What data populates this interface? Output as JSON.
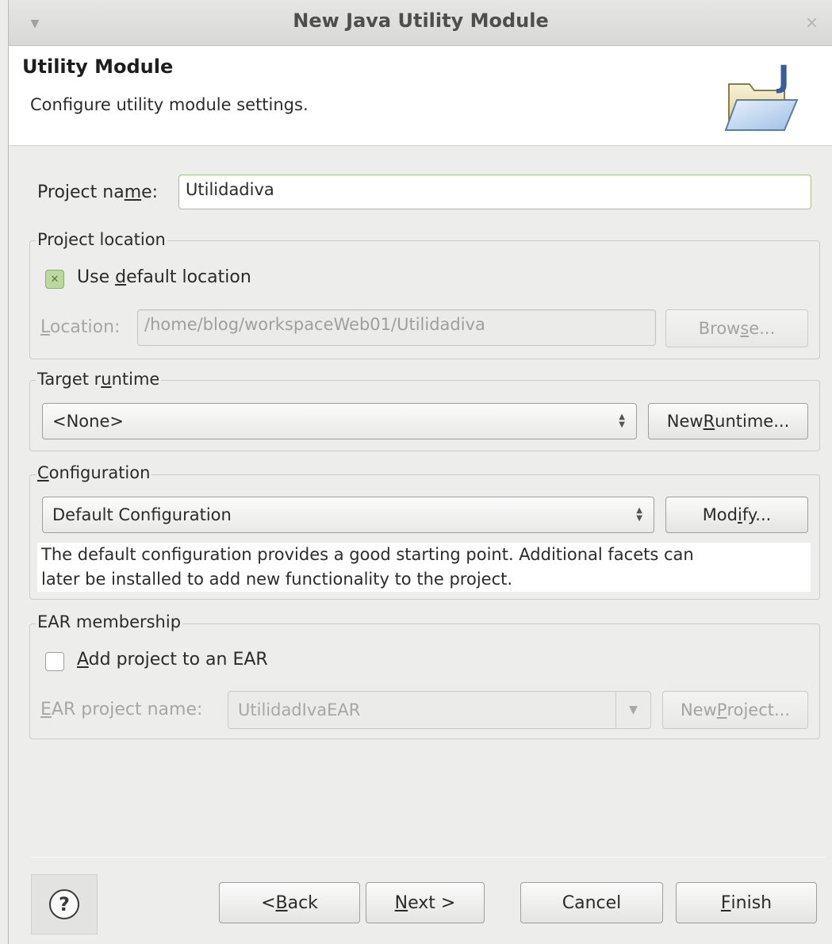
{
  "titlebar": {
    "title": "New Java Utility Module",
    "menu_icon": "chevron-down-icon",
    "close_icon": "close-icon",
    "close_glyph": "×"
  },
  "header": {
    "title": "Utility Module",
    "description": "Configure utility module settings.",
    "icon": "java-folder-icon"
  },
  "project_name": {
    "label_prefix": "Project na",
    "label_mnemonic": "m",
    "label_suffix": "e:",
    "value": "Utilidadiva"
  },
  "project_location": {
    "group_label": "Project location",
    "use_default": {
      "label_prefix": "Use ",
      "label_mnemonic": "d",
      "label_suffix": "efault location",
      "checked": true
    },
    "location": {
      "label_mnemonic": "L",
      "label_suffix": "ocation:",
      "value": "/home/blog/workspaceWeb01/Utilidadiva"
    },
    "browse_button": {
      "prefix": "Brow",
      "mnemonic": "s",
      "suffix": "e..."
    }
  },
  "target_runtime": {
    "group_label_prefix": "Target r",
    "group_label_mnemonic": "u",
    "group_label_suffix": "ntime",
    "selected": "<None>",
    "new_runtime_button": {
      "prefix": "New ",
      "mnemonic": "R",
      "suffix": "untime..."
    }
  },
  "configuration": {
    "group_label_mnemonic": "C",
    "group_label_suffix": "onfiguration",
    "selected": "Default Configuration",
    "modify_button": {
      "prefix": "Mod",
      "mnemonic": "i",
      "suffix": "fy..."
    },
    "description_line1": "The default configuration provides a good starting point. Additional facets can",
    "description_line2": "later be installed to add new functionality to the project."
  },
  "ear_membership": {
    "group_label": "EAR membership",
    "add_to_ear": {
      "label_mnemonic": "A",
      "label_suffix": "dd project to an EAR",
      "checked": false
    },
    "ear_project_name": {
      "label_mnemonic": "E",
      "label_suffix": "AR project name:",
      "value": "UtilidadIvaEAR"
    },
    "new_project_button": {
      "prefix": "New ",
      "mnemonic": "P",
      "suffix": "roject..."
    }
  },
  "footer": {
    "help_icon": "help-icon",
    "help_glyph": "?",
    "back_button": {
      "prefix": "< ",
      "mnemonic": "B",
      "suffix": "ack"
    },
    "next_button": {
      "mnemonic": "N",
      "suffix": "ext >"
    },
    "cancel_button": "Cancel",
    "finish_button": {
      "mnemonic": "F",
      "suffix": "inish"
    }
  },
  "colors": {
    "header_bg": "#ffffff",
    "window_bg": "#ededec",
    "checkbox_checked": "#bcd7a0",
    "field_border_focus": "#a9c28b"
  }
}
